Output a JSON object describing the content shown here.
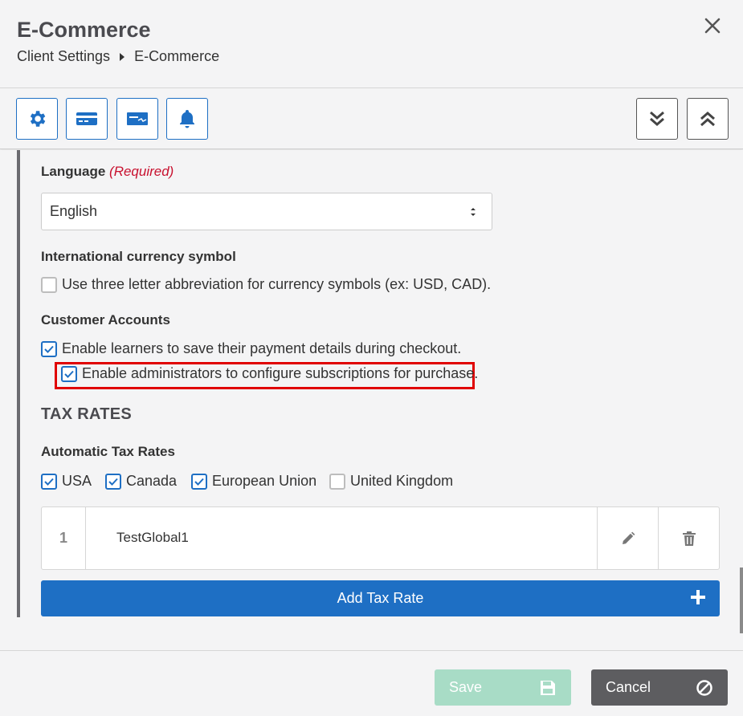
{
  "header": {
    "title": "E-Commerce",
    "breadcrumb": [
      "Client Settings",
      "E-Commerce"
    ]
  },
  "toolbar": {
    "buttons": [
      "gear-icon",
      "card-icon",
      "check-icon",
      "bell-icon"
    ],
    "right_buttons": [
      "expand-all-icon",
      "collapse-all-icon"
    ]
  },
  "language": {
    "label": "Language",
    "required": "(Required)",
    "value": "English"
  },
  "currency": {
    "label": "International currency symbol",
    "checkbox_label": "Use three letter abbreviation for currency symbols (ex: USD, CAD).",
    "checked": false
  },
  "customer_accounts": {
    "label": "Customer Accounts",
    "save_details_label": "Enable learners to save their payment details during checkout.",
    "save_details_checked": true,
    "subscriptions_label": "Enable administrators to configure subscriptions for purchase.",
    "subscriptions_checked": true
  },
  "tax_rates": {
    "section_title": "TAX RATES",
    "automatic_label": "Automatic Tax Rates",
    "regions": [
      {
        "label": "USA",
        "checked": true
      },
      {
        "label": "Canada",
        "checked": true
      },
      {
        "label": "European Union",
        "checked": true
      },
      {
        "label": "United Kingdom",
        "checked": false
      }
    ],
    "rows": [
      {
        "index": "1",
        "name": "TestGlobal1"
      }
    ],
    "add_label": "Add Tax Rate"
  },
  "footer": {
    "save_label": "Save",
    "cancel_label": "Cancel"
  },
  "colors": {
    "primary": "#1e6fc4",
    "save_disabled": "#a8dcc6",
    "cancel": "#5d5d60",
    "required": "#c8102e",
    "highlight": "#e00000"
  }
}
